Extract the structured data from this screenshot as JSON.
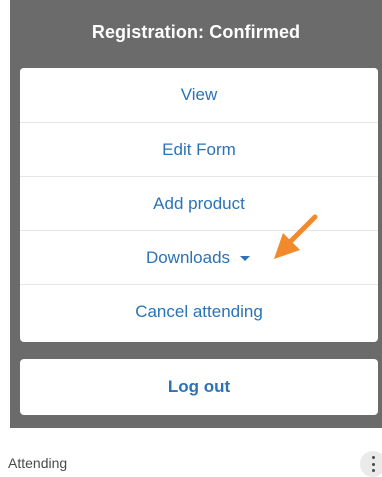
{
  "dialog": {
    "title": "Registration: Confirmed"
  },
  "menu": {
    "items": [
      {
        "label": "View"
      },
      {
        "label": "Edit Form"
      },
      {
        "label": "Add product"
      },
      {
        "label": "Downloads",
        "icon": "caret-down"
      },
      {
        "label": "Cancel attending"
      }
    ],
    "logout_label": "Log out"
  },
  "background": {
    "status_label": "Attending",
    "more_icon": "kebab-vertical"
  },
  "colors": {
    "overlay": "#6b6b6b",
    "link": "#2a73b8",
    "annotation": "#f08a2b"
  }
}
